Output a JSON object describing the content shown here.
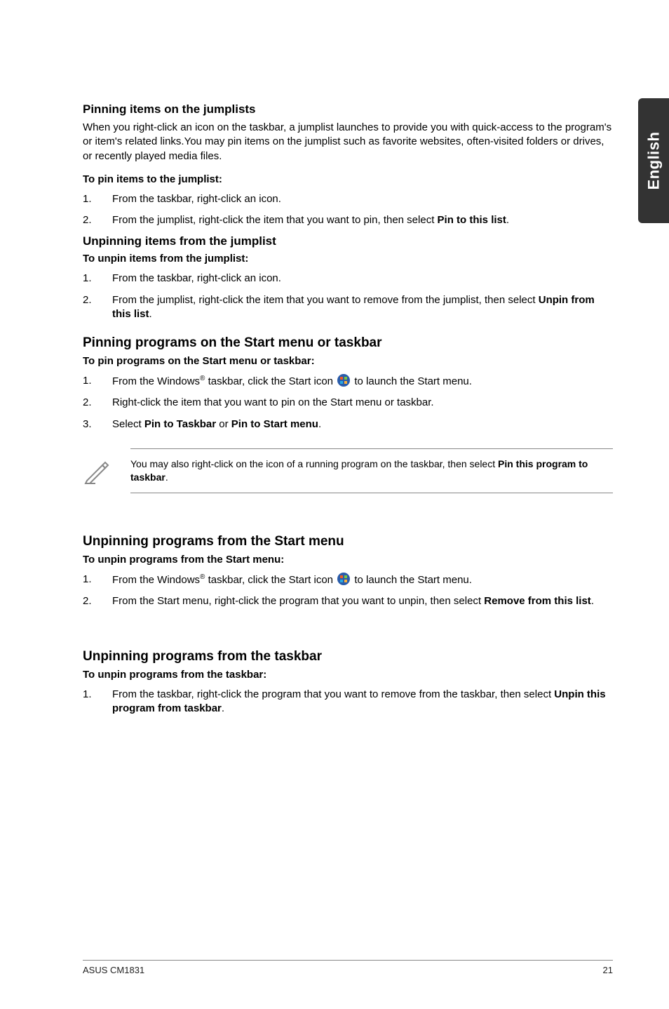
{
  "side_tab": "English",
  "section1": {
    "heading": "Pinning items on the jumplists",
    "intro": "When you right-click an icon on the taskbar, a jumplist launches to provide you with quick-access to the program's or item's related links.You may pin items on the jumplist such as favorite websites, often-visited folders or drives, or recently played media files.",
    "sub": "To pin items to the jumplist:",
    "steps": [
      "From the taskbar, right-click an icon.",
      ""
    ],
    "step2_prefix": "From the jumplist, right-click the item that you want to pin, then select ",
    "step2_bold": "Pin to this list",
    "step2_suffix": "."
  },
  "section2": {
    "heading": "Unpinning items from the jumplist",
    "sub": "To unpin items from the jumplist:",
    "step1": "From the taskbar, right-click an icon.",
    "step2_prefix": "From the jumplist, right-click the item that you want to remove from the jumplist, then select ",
    "step2_bold": "Unpin from this list",
    "step2_suffix": "."
  },
  "section3": {
    "heading": "Pinning programs on the Start menu or taskbar",
    "sub": "To pin programs on the Start menu or taskbar:",
    "step1_a": "From the Windows",
    "step1_b": " taskbar, click the Start icon ",
    "step1_c": " to launch the Start menu.",
    "step2": "Right-click the item that you want to pin on the Start menu or taskbar.",
    "step3_a": "Select ",
    "step3_b": "Pin to Taskbar",
    "step3_c": " or ",
    "step3_d": "Pin to Start menu",
    "step3_e": "."
  },
  "note": {
    "line_a": "You may also right-click on the icon of a running program on the taskbar, then select ",
    "line_b": "Pin this program to taskbar",
    "line_c": "."
  },
  "section4": {
    "heading": "Unpinning programs from the Start menu",
    "sub": "To unpin programs from the Start menu:",
    "step1_a": "From the Windows",
    "step1_b": " taskbar, click the Start icon ",
    "step1_c": " to launch the Start menu.",
    "step2_a": "From the Start menu, right-click the program that you want to unpin, then select ",
    "step2_b": "Remove from this list",
    "step2_c": "."
  },
  "section5": {
    "heading": "Unpinning programs from the taskbar",
    "sub": "To unpin programs from the taskbar:",
    "step1_a": "From the taskbar, right-click the program that you want to remove from the taskbar, then select ",
    "step1_b": "Unpin this program from taskbar",
    "step1_c": "."
  },
  "footer": {
    "left": "ASUS CM1831",
    "right": "21"
  },
  "nums": [
    "1.",
    "2.",
    "3."
  ],
  "reg": "®"
}
